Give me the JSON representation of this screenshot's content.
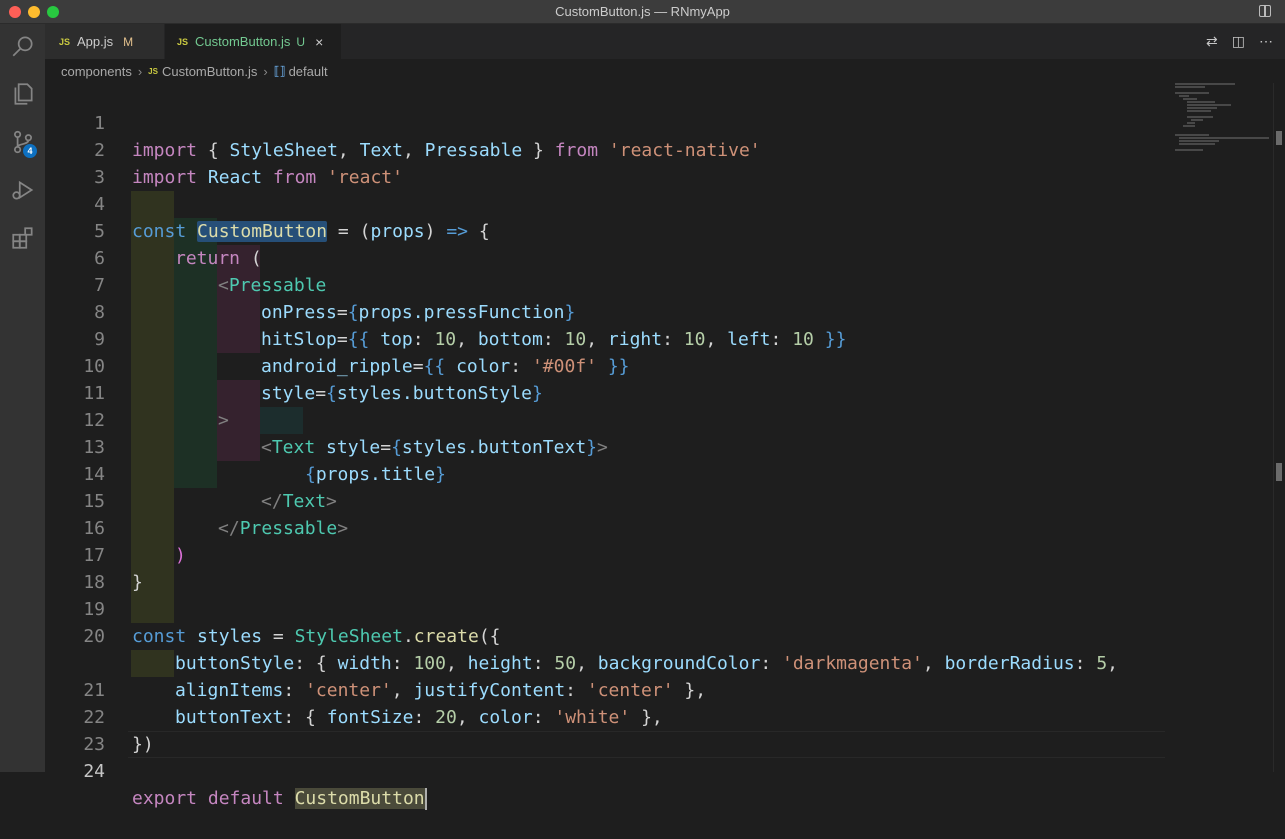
{
  "window": {
    "title": "CustomButton.js — RNmyApp"
  },
  "activity_bar": {
    "scm_badge": "4"
  },
  "tabs": [
    {
      "label": "App.js",
      "status": "M",
      "icon": "js-file-icon"
    },
    {
      "label": "CustomButton.js",
      "status": "U",
      "icon": "js-file-icon",
      "close": "×"
    }
  ],
  "breadcrumb": {
    "folder": "components",
    "file": "CustomButton.js",
    "symbol": "default"
  },
  "editor": {
    "line_numbers": [
      "1",
      "2",
      "3",
      "4",
      "5",
      "6",
      "7",
      "8",
      "9",
      "10",
      "11",
      "12",
      "13",
      "14",
      "15",
      "16",
      "17",
      "18",
      "19",
      "20",
      "",
      "21",
      "22",
      "23",
      "24"
    ],
    "code": {
      "l1_import": "import",
      "l1_a": " { ",
      "l1_stylesheet": "StyleSheet",
      "l1_b": ", ",
      "l1_text": "Text",
      "l1_c": ", ",
      "l1_pressable": "Pressable",
      "l1_d": " } ",
      "l1_from": "from",
      "l1_e": " ",
      "l1_module": "'react-native'",
      "l2_import": "import",
      "l2_a": " ",
      "l2_react": "React",
      "l2_b": " ",
      "l2_from": "from",
      "l2_c": " ",
      "l2_module": "'react'",
      "l4_const": "const",
      "l4_a": " ",
      "l4_name": "CustomButton",
      "l4_b": " = (",
      "l4_props": "props",
      "l4_c": ") ",
      "l4_arrow": "=>",
      "l4_d": " {",
      "l5_return": "return",
      "l5_a": " (",
      "l6_lt": "<",
      "l6_tag": "Pressable",
      "l7_attr": "onPress",
      "l7_eq": "=",
      "l7_ob": "{",
      "l7_val": "props.pressFunction",
      "l7_cb": "}",
      "l8_attr": "hitSlop",
      "l8_eq": "=",
      "l8_ob": "{{",
      "l8_top": " top",
      "l8_a": ": ",
      "l8_n1": "10",
      "l8_b": ", ",
      "l8_bottom": "bottom",
      "l8_c": ": ",
      "l8_n2": "10",
      "l8_d": ", ",
      "l8_right": "right",
      "l8_e": ": ",
      "l8_n3": "10",
      "l8_f": ", ",
      "l8_left": "left",
      "l8_g": ": ",
      "l8_n4": "10",
      "l8_cb": " }}",
      "l9_attr": "android_ripple",
      "l9_eq": "=",
      "l9_ob": "{{",
      "l9_color": " color",
      "l9_a": ": ",
      "l9_val": "'#00f'",
      "l9_cb": " }}",
      "l10_attr": "style",
      "l10_eq": "=",
      "l10_ob": "{",
      "l10_val": "styles.buttonStyle",
      "l10_cb": "}",
      "l11_gt": ">",
      "l12_lt": "<",
      "l12_tag": "Text",
      "l12_a": " ",
      "l12_attr": "style",
      "l12_eq": "=",
      "l12_ob": "{",
      "l12_val": "styles.buttonText",
      "l12_cb": "}",
      "l12_gt": ">",
      "l13_ob": "{",
      "l13_val": "props.title",
      "l13_cb": "}",
      "l14_lt": "</",
      "l14_tag": "Text",
      "l14_gt": ">",
      "l15_lt": "</",
      "l15_tag": "Pressable",
      "l15_gt": ">",
      "l16_paren": ")",
      "l17_brace": "}",
      "l19_const": "const",
      "l19_a": " ",
      "l19_styles": "styles",
      "l19_b": " = ",
      "l19_ss": "StyleSheet",
      "l19_c": ".",
      "l19_create": "create",
      "l19_d": "({",
      "l20_key": "buttonStyle",
      "l20_a": ": { ",
      "l20_width": "width",
      "l20_b": ": ",
      "l20_n1": "100",
      "l20_c": ", ",
      "l20_height": "height",
      "l20_d": ": ",
      "l20_n2": "50",
      "l20_e": ", ",
      "l20_bg": "backgroundColor",
      "l20_f": ": ",
      "l20_s1": "'darkmagenta'",
      "l20_g": ", ",
      "l20_br": "borderRadius",
      "l20_h": ": ",
      "l20_n3": "5",
      "l20_i": ",",
      "l20w_align": "alignItems",
      "l20w_a": ": ",
      "l20w_s1": "'center'",
      "l20w_b": ", ",
      "l20w_jc": "justifyContent",
      "l20w_c": ": ",
      "l20w_s2": "'center'",
      "l20w_d": " },",
      "l21_key": "buttonText",
      "l21_a": ": { ",
      "l21_fs": "fontSize",
      "l21_b": ": ",
      "l21_n1": "20",
      "l21_c": ", ",
      "l21_color": "color",
      "l21_d": ": ",
      "l21_s1": "'white'",
      "l21_e": " },",
      "l22_close": "})",
      "l24_export": "export",
      "l24_a": " ",
      "l24_default": "default",
      "l24_b": " ",
      "l24_name": "CustomButton"
    }
  }
}
